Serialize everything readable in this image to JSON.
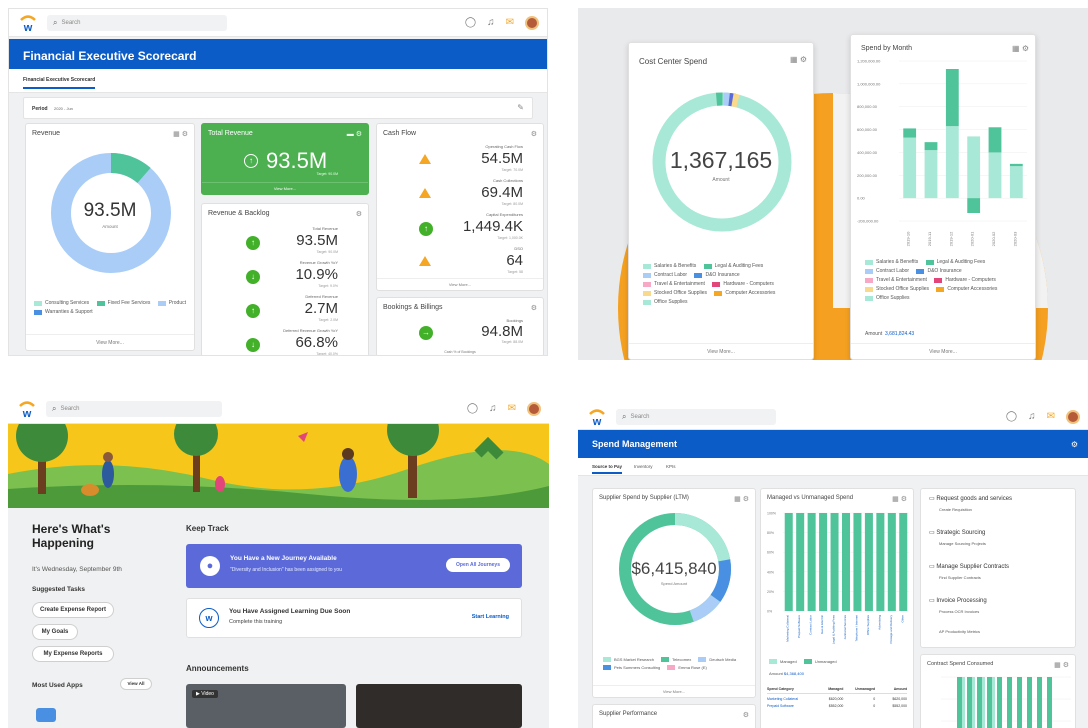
{
  "colors": {
    "brand_blue": "#0b5cc7",
    "green": "#43b02a",
    "orange": "#f5a623",
    "mint": "#a7e8d6",
    "teal": "#4fc39a",
    "light_blue": "#a9cdf7",
    "mid_blue": "#4a90e2",
    "pink": "#f7a8c4",
    "magenta": "#e2457a",
    "yellow": "#f9d98c",
    "purple_card": "#5b6ad8"
  },
  "common": {
    "search_placeholder": "Search"
  },
  "scorecard": {
    "title": "Financial Executive Scorecard",
    "tab": "Financial Executive Scorecard",
    "period_label": "Period",
    "period_value": "2020 - Jun",
    "revenue": {
      "title": "Revenue",
      "value": "93.5M",
      "sub": "Amount",
      "legend": [
        "Consulting Services",
        "Fixed Fee Services",
        "Product",
        "Warranties & Support"
      ],
      "view_more": "View More..."
    },
    "total_revenue": {
      "title": "Total Revenue",
      "value": "93.5M",
      "target": "Target: 90.0M",
      "view_more": "View More..."
    },
    "backlog": {
      "title": "Revenue & Backlog",
      "rows": [
        {
          "label": "Total Revenue",
          "value": "93.5M",
          "target": "Target: 90.0M",
          "dir": "↑"
        },
        {
          "label": "Revenue Growth YoY",
          "value": "10.9%",
          "target": "Target: 9.0%",
          "dir": "↓"
        },
        {
          "label": "Deferred Revenue",
          "value": "2.7M",
          "target": "Target: 2.0M",
          "dir": "↑"
        },
        {
          "label": "Deferred Revenue Growth YoY",
          "value": "66.8%",
          "target": "Target: 40.0%",
          "dir": "↓"
        }
      ]
    },
    "cashflow": {
      "title": "Cash Flow",
      "rows": [
        {
          "label": "Operating Cash Flow",
          "value": "54.5M",
          "target": "Target: 70.0M"
        },
        {
          "label": "Cash Collections",
          "value": "69.4M",
          "target": "Target: 80.0M"
        },
        {
          "label": "Capital Expenditures",
          "value": "1,449.4K",
          "target": "Target: 1,000.0K"
        },
        {
          "label": "DSO",
          "value": "64",
          "target": "Target: 58"
        }
      ],
      "view_more": "View More..."
    },
    "bookings": {
      "title": "Bookings & Billings",
      "label": "Bookings",
      "value": "94.8M",
      "target": "Target: 88.0M",
      "footer": "Cash % of Bookings"
    }
  },
  "cost_center": {
    "title": "Cost Center Spend",
    "value": "1,367,165",
    "sub": "Amount",
    "legend": [
      "Salaries & Benefits",
      "Legal & Auditing Fees",
      "Contract Labor",
      "D&O Insurance",
      "Travel & Entertainment",
      "Hardware - Computers",
      "Stocked Office Supplies",
      "Computer Accessories",
      "Office Supplies"
    ],
    "view_more": "View More..."
  },
  "spend_by_month": {
    "title": "Spend by Month",
    "legend": [
      "Salaries & Benefits",
      "Legal & Auditing Fees",
      "Contract Labor",
      "D&O Insurance",
      "Travel & Entertainment",
      "Hardware - Computers",
      "Stocked Office Supplies",
      "Computer Accessories",
      "Office Supplies"
    ],
    "amount_label": "Amount",
    "amount_value": "3,681,824.43",
    "view_more": "View More..."
  },
  "chart_data": [
    {
      "type": "bar",
      "title": "Spend by Month",
      "categories": [
        "2019-10",
        "2019-11",
        "2019-12",
        "2020-01",
        "2020-02",
        "2020-03"
      ],
      "series": [
        {
          "name": "Salaries & Benefits",
          "values": [
            530000,
            420000,
            630000,
            540000,
            400000,
            280000
          ]
        },
        {
          "name": "Legal & Auditing Fees",
          "values": [
            80000,
            70000,
            500000,
            -130000,
            220000,
            20000
          ]
        }
      ],
      "yticks": [
        "1,200,000.00",
        "1,000,000.00",
        "800,000.00",
        "600,000.00",
        "400,000.00",
        "200,000.00",
        "0.00",
        "-200,000.00"
      ],
      "ylim": [
        -200000,
        1200000
      ]
    },
    {
      "type": "bar",
      "title": "Managed vs Unmanaged Spend",
      "categories": [
        "Marketing Collateral",
        "Prepaid Software",
        "Contract Labor",
        "Gas & Electric",
        "Legal & Auditing Fees",
        "Janitorial Services",
        "Telephone / Internet",
        "Office Supplies",
        "Advertising",
        "Postage and Delivery",
        "Other"
      ],
      "series": [
        {
          "name": "Managed",
          "values": [
            100,
            100,
            100,
            100,
            100,
            100,
            100,
            100,
            100,
            100,
            100
          ]
        }
      ],
      "yticks": [
        "100%",
        "80%",
        "60%",
        "40%",
        "20%",
        "0%"
      ],
      "ylim": [
        0,
        100
      ]
    }
  ],
  "home": {
    "heading_line1": "Here's What's",
    "heading_line2": "Happening",
    "date": "It's Wednesday, September 9th",
    "suggested": "Suggested Tasks",
    "tasks": [
      "Create Expense Report",
      "My Goals",
      "My Expense Reports"
    ],
    "most_used": "Most Used Apps",
    "view_all": "View All",
    "keep_track": "Keep Track",
    "journey_title": "You Have a New Journey Available",
    "journey_sub": "\"Diversity and Inclusion\" has been assigned to you",
    "journey_btn": "Open All Journeys",
    "learning_title": "You Have Assigned Learning Due Soon",
    "learning_sub": "Complete this training",
    "learning_btn": "Start Learning",
    "announcements": "Announcements",
    "video_tag": "Video"
  },
  "spend_mgmt": {
    "title": "Spend Management",
    "tabs": [
      "Source to Pay",
      "Inventory",
      "KPIs"
    ],
    "supplier_title": "Supplier Spend by Supplier (LTM)",
    "supplier_value": "$6,415,840",
    "supplier_sub": "Spend Amount",
    "supplier_legend": [
      "BGS Market Research",
      "Telecomex",
      "Deutsch Media",
      "Pets Summers Consulting",
      "Emma Rose (E)"
    ],
    "view_more": "View More...",
    "performance_title": "Supplier Performance",
    "managed_title": "Managed vs Unmanaged Spend",
    "managed_legend": [
      "Managed",
      "Unmanaged"
    ],
    "amount_label": "Amount",
    "amount_value": "$4,368,400",
    "table_headers": [
      "Spend Category",
      "Managed",
      "Unmanaged",
      "Amount"
    ],
    "table_rows": [
      [
        "Marketing Collateral",
        "$620,000",
        "0",
        "$620,000"
      ],
      [
        "Prepaid Software",
        "$552,000",
        "0",
        "$552,000"
      ]
    ],
    "actions": [
      {
        "title": "Request goods and services",
        "sub": "Create Requisition"
      },
      {
        "title": "Strategic Sourcing",
        "sub": "Manage Sourcing Projects"
      },
      {
        "title": "Manage Supplier Contracts",
        "sub": "Find Supplier Contracts"
      },
      {
        "title": "Invoice Processing",
        "sub": "Process OCR Invoices"
      },
      {
        "title": "",
        "sub": "AP Productivity Metrics"
      }
    ],
    "contract_title": "Contract Spend Consumed"
  }
}
